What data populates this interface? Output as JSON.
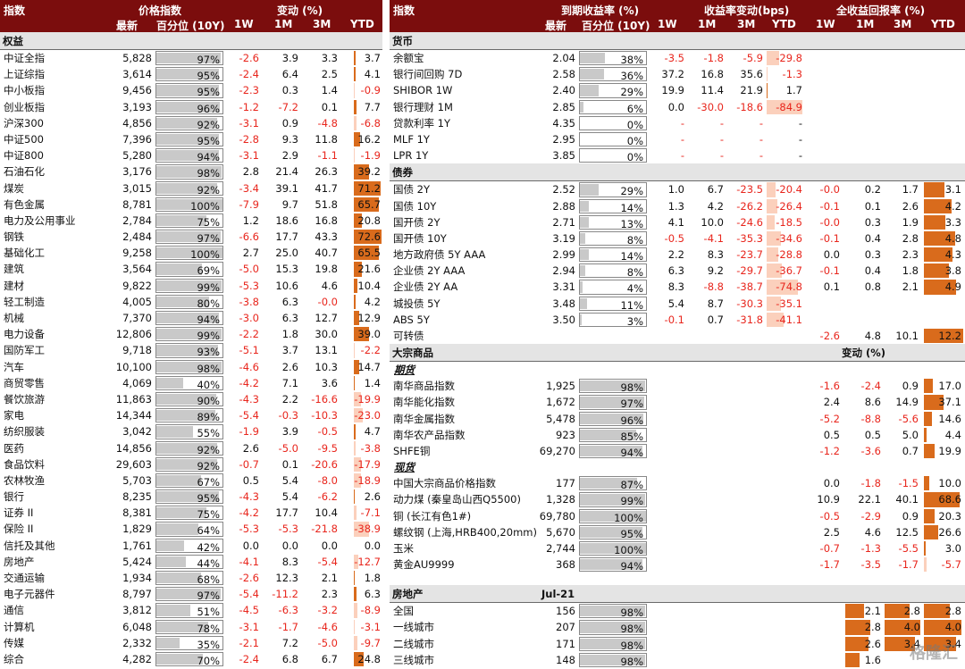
{
  "left": {
    "header": {
      "index": "指数",
      "price_index": "价格指数",
      "change": "变动 (%)",
      "latest": "最新",
      "pct10y": "百分位 (10Y)",
      "w1": "1W",
      "m1": "1M",
      "m3": "3M",
      "ytd": "YTD"
    },
    "section": "权益",
    "rows": [
      {
        "name": "中证全指",
        "latest": "5,828",
        "pct": 97,
        "w1": "-2.6",
        "m1": "3.9",
        "m3": "3.3",
        "ytd": "3.7"
      },
      {
        "name": "上证综指",
        "latest": "3,614",
        "pct": 95,
        "w1": "-2.4",
        "m1": "6.4",
        "m3": "2.5",
        "ytd": "4.1"
      },
      {
        "name": "中小板指",
        "latest": "9,456",
        "pct": 95,
        "w1": "-2.3",
        "m1": "0.3",
        "m3": "1.4",
        "ytd": "-0.9"
      },
      {
        "name": "创业板指",
        "latest": "3,193",
        "pct": 96,
        "w1": "-1.2",
        "m1": "-7.2",
        "m3": "0.1",
        "ytd": "7.7"
      },
      {
        "name": "沪深300",
        "latest": "4,856",
        "pct": 92,
        "w1": "-3.1",
        "m1": "0.9",
        "m3": "-4.8",
        "ytd": "-6.8"
      },
      {
        "name": "中证500",
        "latest": "7,396",
        "pct": 95,
        "w1": "-2.8",
        "m1": "9.3",
        "m3": "11.8",
        "ytd": "16.2"
      },
      {
        "name": "中证800",
        "latest": "5,280",
        "pct": 94,
        "w1": "-3.1",
        "m1": "2.9",
        "m3": "-1.1",
        "ytd": "-1.9"
      },
      {
        "name": "石油石化",
        "latest": "3,176",
        "pct": 98,
        "w1": "2.8",
        "m1": "21.4",
        "m3": "26.3",
        "ytd": "39.2"
      },
      {
        "name": "煤炭",
        "latest": "3,015",
        "pct": 92,
        "w1": "-3.4",
        "m1": "39.1",
        "m3": "41.7",
        "ytd": "71.2"
      },
      {
        "name": "有色金属",
        "latest": "8,781",
        "pct": 100,
        "w1": "-7.9",
        "m1": "9.7",
        "m3": "51.8",
        "ytd": "65.7"
      },
      {
        "name": "电力及公用事业",
        "latest": "2,784",
        "pct": 75,
        "w1": "1.2",
        "m1": "18.6",
        "m3": "16.8",
        "ytd": "20.8"
      },
      {
        "name": "钢铁",
        "latest": "2,484",
        "pct": 97,
        "w1": "-6.6",
        "m1": "17.7",
        "m3": "43.3",
        "ytd": "72.6"
      },
      {
        "name": "基础化工",
        "latest": "9,258",
        "pct": 100,
        "w1": "2.7",
        "m1": "25.0",
        "m3": "40.7",
        "ytd": "65.5"
      },
      {
        "name": "建筑",
        "latest": "3,564",
        "pct": 69,
        "w1": "-5.0",
        "m1": "15.3",
        "m3": "19.8",
        "ytd": "21.6"
      },
      {
        "name": "建材",
        "latest": "9,822",
        "pct": 99,
        "w1": "-5.3",
        "m1": "10.6",
        "m3": "4.6",
        "ytd": "10.4"
      },
      {
        "name": "轻工制造",
        "latest": "4,005",
        "pct": 80,
        "w1": "-3.8",
        "m1": "6.3",
        "m3": "-0.0",
        "ytd": "4.2"
      },
      {
        "name": "机械",
        "latest": "7,370",
        "pct": 94,
        "w1": "-3.0",
        "m1": "6.3",
        "m3": "12.7",
        "ytd": "12.9"
      },
      {
        "name": "电力设备",
        "latest": "12,806",
        "pct": 99,
        "w1": "-2.2",
        "m1": "1.8",
        "m3": "30.0",
        "ytd": "39.0"
      },
      {
        "name": "国防军工",
        "latest": "9,718",
        "pct": 93,
        "w1": "-5.1",
        "m1": "3.7",
        "m3": "13.1",
        "ytd": "-2.2"
      },
      {
        "name": "汽车",
        "latest": "10,100",
        "pct": 98,
        "w1": "-4.6",
        "m1": "2.6",
        "m3": "10.3",
        "ytd": "14.7"
      },
      {
        "name": "商贸零售",
        "latest": "4,069",
        "pct": 40,
        "w1": "-4.2",
        "m1": "7.1",
        "m3": "3.6",
        "ytd": "1.4"
      },
      {
        "name": "餐饮旅游",
        "latest": "11,863",
        "pct": 90,
        "w1": "-4.3",
        "m1": "2.2",
        "m3": "-16.6",
        "ytd": "-19.9"
      },
      {
        "name": "家电",
        "latest": "14,344",
        "pct": 89,
        "w1": "-5.4",
        "m1": "-0.3",
        "m3": "-10.3",
        "ytd": "-23.0"
      },
      {
        "name": "纺织服装",
        "latest": "3,042",
        "pct": 55,
        "w1": "-1.9",
        "m1": "3.9",
        "m3": "-0.5",
        "ytd": "4.7"
      },
      {
        "name": "医药",
        "latest": "14,856",
        "pct": 92,
        "w1": "2.6",
        "m1": "-5.0",
        "m3": "-9.5",
        "ytd": "-3.8"
      },
      {
        "name": "食品饮料",
        "latest": "29,603",
        "pct": 92,
        "w1": "-0.7",
        "m1": "0.1",
        "m3": "-20.6",
        "ytd": "-17.9"
      },
      {
        "name": "农林牧渔",
        "latest": "5,703",
        "pct": 67,
        "w1": "0.5",
        "m1": "5.4",
        "m3": "-8.0",
        "ytd": "-18.9"
      },
      {
        "name": "银行",
        "latest": "8,235",
        "pct": 95,
        "w1": "-4.3",
        "m1": "5.4",
        "m3": "-6.2",
        "ytd": "2.6"
      },
      {
        "name": "证券 II",
        "latest": "8,381",
        "pct": 75,
        "w1": "-4.2",
        "m1": "17.7",
        "m3": "10.4",
        "ytd": "-7.1"
      },
      {
        "name": "保险 II",
        "latest": "1,829",
        "pct": 64,
        "w1": "-5.3",
        "m1": "-5.3",
        "m3": "-21.8",
        "ytd": "-38.9"
      },
      {
        "name": "信托及其他",
        "latest": "1,761",
        "pct": 42,
        "w1": "0.0",
        "m1": "0.0",
        "m3": "0.0",
        "ytd": "0.0"
      },
      {
        "name": "房地产",
        "latest": "5,424",
        "pct": 44,
        "w1": "-4.1",
        "m1": "8.3",
        "m3": "-5.4",
        "ytd": "-12.7"
      },
      {
        "name": "交通运输",
        "latest": "1,934",
        "pct": 68,
        "w1": "-2.6",
        "m1": "12.3",
        "m3": "2.1",
        "ytd": "1.8"
      },
      {
        "name": "电子元器件",
        "latest": "8,797",
        "pct": 97,
        "w1": "-5.4",
        "m1": "-11.2",
        "m3": "2.3",
        "ytd": "6.3"
      },
      {
        "name": "通信",
        "latest": "3,812",
        "pct": 51,
        "w1": "-4.5",
        "m1": "-6.3",
        "m3": "-3.2",
        "ytd": "-8.9"
      },
      {
        "name": "计算机",
        "latest": "6,048",
        "pct": 78,
        "w1": "-3.1",
        "m1": "-1.7",
        "m3": "-4.6",
        "ytd": "-3.1"
      },
      {
        "name": "传媒",
        "latest": "2,332",
        "pct": 35,
        "w1": "-2.1",
        "m1": "7.2",
        "m3": "-5.0",
        "ytd": "-9.7"
      },
      {
        "name": "综合",
        "latest": "4,282",
        "pct": 70,
        "w1": "-2.4",
        "m1": "6.8",
        "m3": "6.7",
        "ytd": "24.8"
      }
    ]
  },
  "right": {
    "header": {
      "index": "指数",
      "ytm": "到期收益率 (%)",
      "yield_change": "收益率变动(bps)",
      "total_return": "全收益回报率 (%)",
      "latest": "最新",
      "pct10y": "百分位 (10Y)",
      "w1": "1W",
      "m1": "1M",
      "m3": "3M",
      "ytd": "YTD",
      "w1b": "1W",
      "m1b": "1M",
      "m3b": "3M",
      "ytdb": "YTD"
    },
    "money": {
      "title": "货币",
      "rows": [
        {
          "name": "余额宝",
          "latest": "2.04",
          "pct": 38,
          "w1": "-3.5",
          "m1": "-1.8",
          "m3": "-5.9",
          "ytd": "-29.8"
        },
        {
          "name": "银行间回购 7D",
          "latest": "2.58",
          "pct": 36,
          "w1": "37.2",
          "m1": "16.8",
          "m3": "35.6",
          "ytd": "-1.3"
        },
        {
          "name": "SHIBOR 1W",
          "latest": "2.40",
          "pct": 29,
          "w1": "19.9",
          "m1": "11.4",
          "m3": "21.9",
          "ytd": "1.7"
        },
        {
          "name": "银行理财 1M",
          "latest": "2.85",
          "pct": 6,
          "w1": "0.0",
          "m1": "-30.0",
          "m3": "-18.6",
          "ytd": "-84.9"
        },
        {
          "name": "贷款利率 1Y",
          "latest": "4.35",
          "pct": 0,
          "w1": "-",
          "m1": "-",
          "m3": "-",
          "ytd": "-"
        },
        {
          "name": "MLF 1Y",
          "latest": "2.95",
          "pct": 0,
          "w1": "-",
          "m1": "-",
          "m3": "-",
          "ytd": "-"
        },
        {
          "name": "LPR 1Y",
          "latest": "3.85",
          "pct": 0,
          "w1": "-",
          "m1": "-",
          "m3": "-",
          "ytd": "-"
        }
      ]
    },
    "bonds": {
      "title": "债券",
      "rows": [
        {
          "name": "国债 2Y",
          "latest": "2.52",
          "pct": 29,
          "w1": "1.0",
          "m1": "6.7",
          "m3": "-23.5",
          "ytd": "-20.4",
          "r1w": "-0.0",
          "r1m": "0.2",
          "r3m": "1.7",
          "rytd": "3.1"
        },
        {
          "name": "国债 10Y",
          "latest": "2.88",
          "pct": 14,
          "w1": "1.3",
          "m1": "4.2",
          "m3": "-26.2",
          "ytd": "-26.4",
          "r1w": "-0.1",
          "r1m": "0.1",
          "r3m": "2.6",
          "rytd": "4.2"
        },
        {
          "name": "国开债 2Y",
          "latest": "2.71",
          "pct": 13,
          "w1": "4.1",
          "m1": "10.0",
          "m3": "-24.6",
          "ytd": "-18.5",
          "r1w": "-0.0",
          "r1m": "0.3",
          "r3m": "1.9",
          "rytd": "3.3"
        },
        {
          "name": "国开债 10Y",
          "latest": "3.19",
          "pct": 8,
          "w1": "-0.5",
          "m1": "-4.1",
          "m3": "-35.3",
          "ytd": "-34.6",
          "r1w": "-0.1",
          "r1m": "0.4",
          "r3m": "2.8",
          "rytd": "4.8"
        },
        {
          "name": "地方政府债 5Y AAA",
          "latest": "2.99",
          "pct": 14,
          "w1": "2.2",
          "m1": "8.3",
          "m3": "-23.7",
          "ytd": "-28.8",
          "r1w": "0.0",
          "r1m": "0.3",
          "r3m": "2.3",
          "rytd": "4.3"
        },
        {
          "name": "企业债 2Y AAA",
          "latest": "2.94",
          "pct": 8,
          "w1": "6.3",
          "m1": "9.2",
          "m3": "-29.7",
          "ytd": "-36.7",
          "r1w": "-0.1",
          "r1m": "0.4",
          "r3m": "1.8",
          "rytd": "3.8"
        },
        {
          "name": "企业债 2Y AA",
          "latest": "3.31",
          "pct": 4,
          "w1": "8.3",
          "m1": "-8.8",
          "m3": "-38.7",
          "ytd": "-74.8",
          "r1w": "0.1",
          "r1m": "0.8",
          "r3m": "2.1",
          "rytd": "4.9"
        },
        {
          "name": "城投债 5Y",
          "latest": "3.48",
          "pct": 11,
          "w1": "5.4",
          "m1": "8.7",
          "m3": "-30.3",
          "ytd": "-35.1",
          "r1w": "",
          "r1m": "",
          "r3m": "",
          "rytd": ""
        },
        {
          "name": "ABS 5Y",
          "latest": "3.50",
          "pct": 3,
          "w1": "-0.1",
          "m1": "0.7",
          "m3": "-31.8",
          "ytd": "-41.1",
          "r1w": "",
          "r1m": "",
          "r3m": "",
          "rytd": ""
        },
        {
          "name": "可转债",
          "latest": "",
          "pct": null,
          "w1": "",
          "m1": "",
          "m3": "",
          "ytd": "",
          "r1w": "-2.6",
          "r1m": "4.8",
          "r3m": "10.1",
          "rytd": "12.2"
        }
      ]
    },
    "commodities": {
      "title": "大宗商品",
      "change_label": "变动 (%)",
      "futures_title": "期货",
      "futures": [
        {
          "name": "南华商品指数",
          "latest": "1,925",
          "pct": 98,
          "w1": "-1.6",
          "m1": "-2.4",
          "m3": "0.9",
          "ytd": "17.0"
        },
        {
          "name": "南华能化指数",
          "latest": "1,672",
          "pct": 97,
          "w1": "2.4",
          "m1": "8.6",
          "m3": "14.9",
          "ytd": "37.1"
        },
        {
          "name": "南华金属指数",
          "latest": "5,478",
          "pct": 96,
          "w1": "-5.2",
          "m1": "-8.8",
          "m3": "-5.6",
          "ytd": "14.6"
        },
        {
          "name": "南华农产品指数",
          "latest": "923",
          "pct": 85,
          "w1": "0.5",
          "m1": "0.5",
          "m3": "5.0",
          "ytd": "4.4"
        },
        {
          "name": "SHFE铜",
          "latest": "69,270",
          "pct": 94,
          "w1": "-1.2",
          "m1": "-3.6",
          "m3": "0.7",
          "ytd": "19.9"
        }
      ],
      "spot_title": "现货",
      "spot": [
        {
          "name": "中国大宗商品价格指数",
          "latest": "177",
          "pct": 87,
          "w1": "0.0",
          "m1": "-1.8",
          "m3": "-1.5",
          "ytd": "10.0"
        },
        {
          "name": "动力煤 (秦皇岛山西Q5500)",
          "latest": "1,328",
          "pct": 99,
          "w1": "10.9",
          "m1": "22.1",
          "m3": "40.1",
          "ytd": "68.6"
        },
        {
          "name": "铜 (长江有色1#)",
          "latest": "69,780",
          "pct": 100,
          "w1": "-0.5",
          "m1": "-2.9",
          "m3": "0.9",
          "ytd": "20.3"
        },
        {
          "name": "螺纹钢 (上海,HRB400,20mm)",
          "latest": "5,670",
          "pct": 95,
          "w1": "2.5",
          "m1": "4.6",
          "m3": "12.5",
          "ytd": "26.6"
        },
        {
          "name": "玉米",
          "latest": "2,744",
          "pct": 100,
          "w1": "-0.7",
          "m1": "-1.3",
          "m3": "-5.5",
          "ytd": "3.0"
        },
        {
          "name": "黄金AU9999",
          "latest": "368",
          "pct": 94,
          "w1": "-1.7",
          "m1": "-3.5",
          "m3": "-1.7",
          "ytd": "-5.7"
        }
      ]
    },
    "realestate": {
      "title": "房地产",
      "date": "Jul-21",
      "rows": [
        {
          "name": "全国",
          "latest": "156",
          "pct": 98,
          "m1": "2.1",
          "m3": "2.8",
          "ytd": "2.8"
        },
        {
          "name": "一线城市",
          "latest": "207",
          "pct": 98,
          "m1": "2.8",
          "m3": "4.0",
          "ytd": "4.0"
        },
        {
          "name": "二线城市",
          "latest": "171",
          "pct": 98,
          "m1": "2.6",
          "m3": "3.4",
          "ytd": "3.4"
        },
        {
          "name": "三线城市",
          "latest": "148",
          "pct": 98,
          "m1": "1.6",
          "m3": "",
          "ytd": ""
        }
      ]
    }
  },
  "watermark": "格隆汇",
  "colors": {
    "header_bg": "#7b0d0d",
    "neg_text": "#e8261d",
    "pos_bar": "#d96b1c",
    "neg_bar": "#fbd0bc",
    "pct_bar": "#c9c9c9"
  }
}
